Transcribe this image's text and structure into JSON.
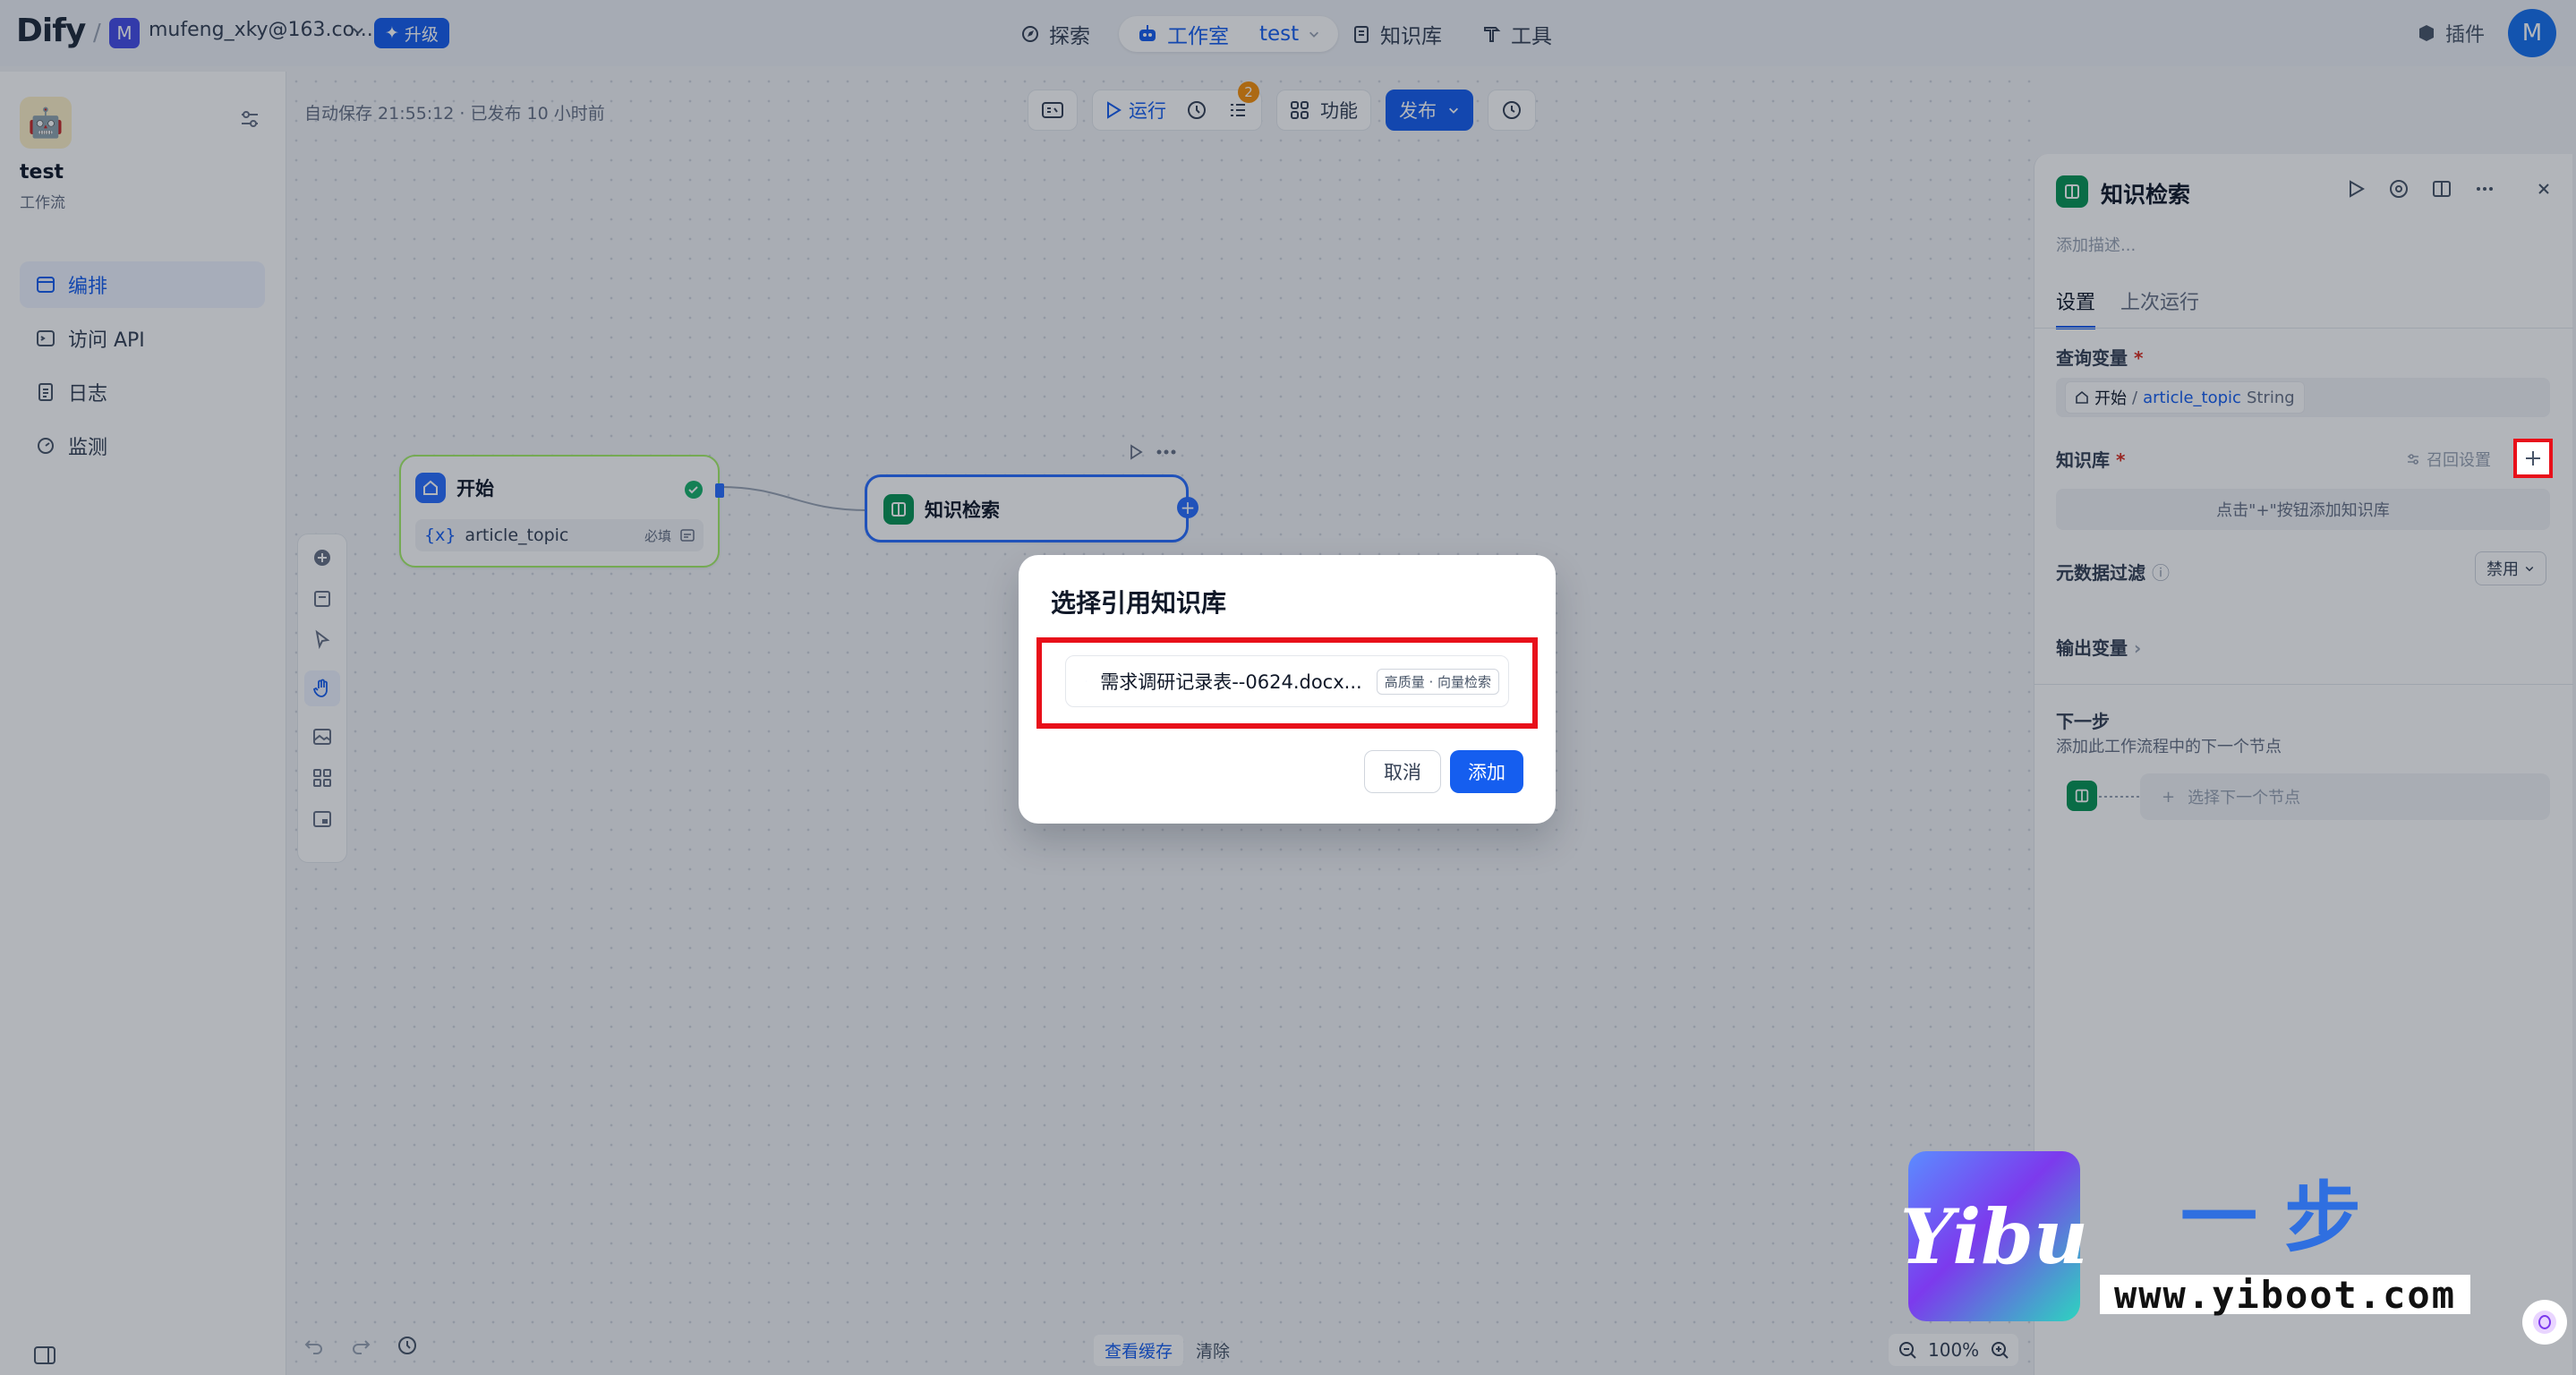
{
  "topbar": {
    "logo": "Dify",
    "workspace_initial": "M",
    "workspace_name": "mufeng_xky@163.co...",
    "upgrade_label": "升级",
    "nav": {
      "explore": "探索",
      "studio": "工作室",
      "studio_app": "test",
      "knowledge": "知识库",
      "tools": "工具"
    },
    "plugins_label": "插件",
    "user_initial": "M"
  },
  "sidebar": {
    "app_name": "test",
    "app_type": "工作流",
    "items": [
      {
        "label": "编排",
        "icon": "orchestrate-icon",
        "active": true
      },
      {
        "label": "访问 API",
        "icon": "api-icon",
        "active": false
      },
      {
        "label": "日志",
        "icon": "logs-icon",
        "active": false
      },
      {
        "label": "监测",
        "icon": "monitor-icon",
        "active": false
      }
    ]
  },
  "canvas": {
    "autosave_text": "自动保存 21:55:12 · 已发布 10 小时前",
    "toolbar": {
      "run_label": "运行",
      "checklist_count": "2",
      "features_label": "功能",
      "publish_label": "发布"
    },
    "nodes": {
      "start": {
        "title": "开始",
        "var_prefix": "{x}",
        "var_name": "article_topic",
        "required": "必填"
      },
      "knowledge_retrieval": {
        "title": "知识检索"
      }
    },
    "bottom": {
      "view_cache": "查看缓存",
      "clear": "清除",
      "zoom": "100%"
    }
  },
  "panel": {
    "title": "知识检索",
    "description_placeholder": "添加描述...",
    "tabs": [
      "设置",
      "上次运行"
    ],
    "query_var_label": "查询变量",
    "query_var": {
      "node": "开始",
      "name": "article_topic",
      "type": "String"
    },
    "knowledge_label": "知识库",
    "recall_settings": "召回设置",
    "knowledge_empty": "点击\"+\"按钮添加知识库",
    "metadata_filter_label": "元数据过滤",
    "metadata_filter_value": "禁用",
    "output_var_label": "输出变量",
    "next_step_title": "下一步",
    "next_step_desc": "添加此工作流程中的下一个节点",
    "next_step_select": "选择下一个节点"
  },
  "modal": {
    "title": "选择引用知识库",
    "item_name": "需求调研记录表--0624.docx...",
    "item_tag": "高质量 · 向量检索",
    "cancel_label": "取消",
    "add_label": "添加"
  },
  "watermark": {
    "logo_text": "Yibu",
    "cn_text": "一步",
    "url": "www.yiboot.com"
  },
  "colors": {
    "primary": "#155eef",
    "highlight_box": "#e8101a",
    "node_green": "#079455"
  }
}
